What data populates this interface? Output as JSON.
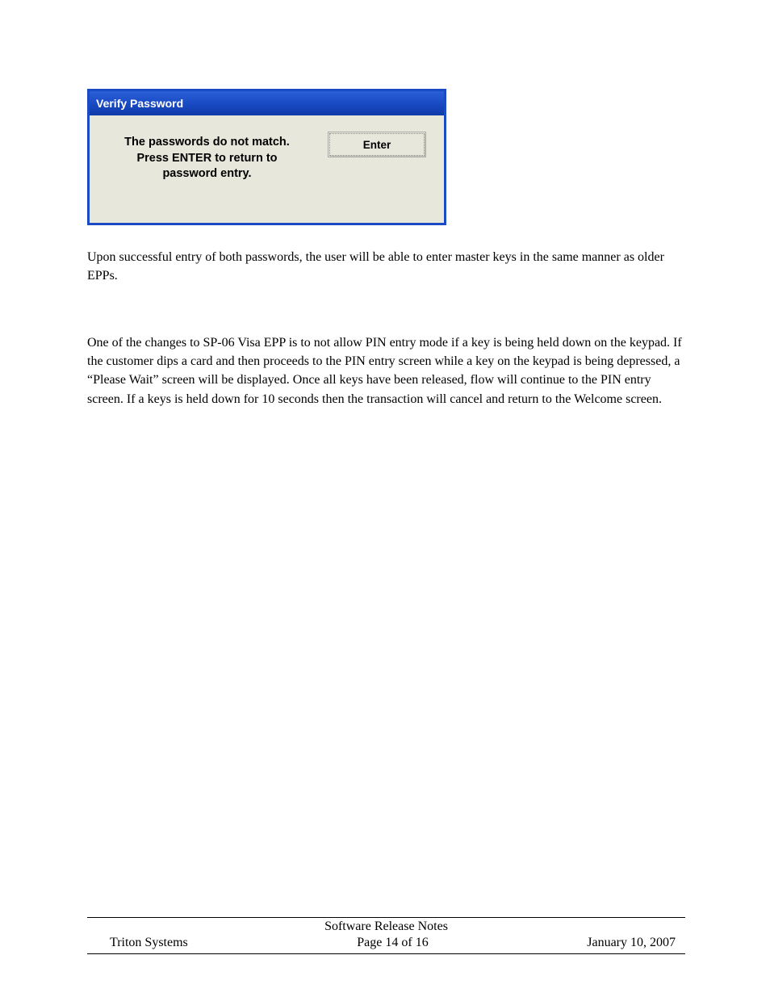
{
  "dialog": {
    "title": "Verify Password",
    "message_line1": "The passwords do not match.",
    "message_line2": "Press ENTER to return to",
    "message_line3": "password entry.",
    "button_label": "Enter"
  },
  "body": {
    "paragraph1": "Upon successful entry of both passwords, the user will be able to enter master keys in the same manner as older EPPs.",
    "paragraph2": "One of the changes to SP-06 Visa EPP is to not allow PIN entry mode if a key is being held down on the keypad.  If the customer dips a card and then proceeds to the PIN entry screen while a key on the keypad is being depressed, a “Please Wait” screen will be displayed.  Once all keys have been released, flow will continue to the PIN entry screen.  If a keys is held down for 10 seconds then the transaction will cancel and return to the Welcome screen."
  },
  "footer": {
    "title": "Software Release Notes",
    "company": "Triton Systems",
    "page": "Page 14 of 16",
    "date": "January 10, 2007"
  }
}
